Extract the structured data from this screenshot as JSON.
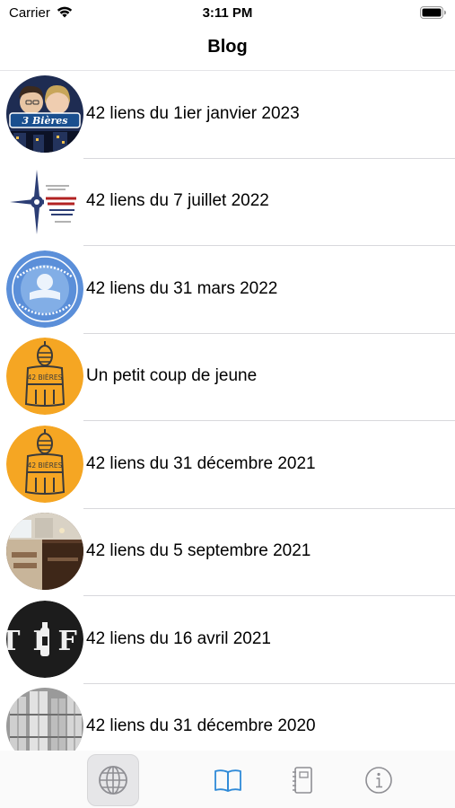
{
  "status_bar": {
    "carrier": "Carrier",
    "time": "3:11 PM",
    "icons": [
      "wifi-icon",
      "battery-icon"
    ]
  },
  "nav": {
    "title": "Blog"
  },
  "posts": [
    {
      "title": "42 liens du 1ier janvier 2023",
      "thumbnail": "3-bieres-logo"
    },
    {
      "title": "42 liens du 7 juillet 2022",
      "thumbnail": "au-vent-du-nord-logo"
    },
    {
      "title": "42 liens du 31 mars 2022",
      "thumbnail": "festival-badge-logo"
    },
    {
      "title": "Un petit coup de jeune",
      "thumbnail": "42-bieres-logo"
    },
    {
      "title": "42 liens du 31 décembre 2021",
      "thumbnail": "42-bieres-logo"
    },
    {
      "title": "42 liens du 5 septembre 2021",
      "thumbnail": "brewpub-interior-photo"
    },
    {
      "title": "42 liens du 16 avril 2021",
      "thumbnail": "tif-logo"
    },
    {
      "title": "42 liens du 31 décembre 2020",
      "thumbnail": "brewery-tanks-photo"
    }
  ],
  "tab_bar": {
    "tabs": [
      {
        "icon": "globe-icon",
        "state": "highlighted"
      },
      {
        "icon": "book-icon",
        "state": "active"
      },
      {
        "icon": "notebook-icon",
        "state": "inactive"
      },
      {
        "icon": "info-icon",
        "state": "inactive"
      }
    ],
    "colors": {
      "active": "#2f8ad8",
      "inactive": "#8e8e93",
      "highlight_bg": "#e6e6e8"
    }
  },
  "thumbnail_text": {
    "three_bieres": "3 Bières",
    "bieres_42": "42 BIÈRES",
    "tif": "TIF"
  }
}
